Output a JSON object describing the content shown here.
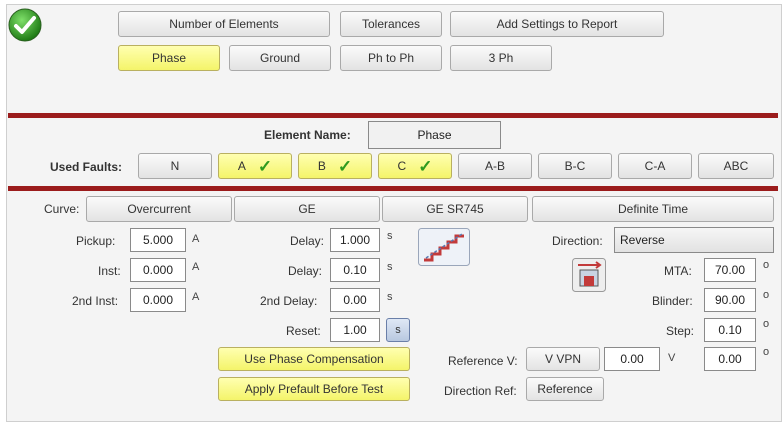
{
  "top_buttons": {
    "number_of_elements": "Number of Elements",
    "tolerances": "Tolerances",
    "add_settings": "Add Settings to Report"
  },
  "fault_type_tabs": [
    "Phase",
    "Ground",
    "Ph to Ph",
    "3 Ph"
  ],
  "element_name": {
    "label": "Element Name:",
    "value": "Phase"
  },
  "used_faults": {
    "label": "Used Faults:",
    "items": [
      {
        "label": "N",
        "selected": false
      },
      {
        "label": "A",
        "selected": true
      },
      {
        "label": "B",
        "selected": true
      },
      {
        "label": "C",
        "selected": true
      },
      {
        "label": "A-B",
        "selected": false
      },
      {
        "label": "B-C",
        "selected": false
      },
      {
        "label": "C-A",
        "selected": false
      },
      {
        "label": "ABC",
        "selected": false
      }
    ],
    "check_mark": "✓"
  },
  "curve": {
    "label": "Curve:",
    "type": "Overcurrent",
    "manufacturer": "GE",
    "model": "GE SR745",
    "characteristic": "Definite Time"
  },
  "settings": {
    "pickup": {
      "label": "Pickup:",
      "value": "5.000",
      "unit": "A"
    },
    "inst": {
      "label": "Inst:",
      "value": "0.000",
      "unit": "A"
    },
    "inst2": {
      "label": "2nd Inst:",
      "value": "0.000",
      "unit": "A"
    },
    "delay": {
      "label": "Delay:",
      "value": "1.000",
      "unit": "s"
    },
    "delay_b": {
      "label": "Delay:",
      "value": "0.10",
      "unit": "s"
    },
    "delay2": {
      "label": "2nd Delay:",
      "value": "0.00",
      "unit": "s"
    },
    "reset": {
      "label": "Reset:",
      "value": "1.00",
      "unit": "s"
    }
  },
  "direction": {
    "label": "Direction:",
    "value": "Reverse",
    "mta": {
      "label": "MTA:",
      "value": "70.00",
      "unit": "o"
    },
    "blinder": {
      "label": "Blinder:",
      "value": "90.00",
      "unit": "o"
    },
    "step": {
      "label": "Step:",
      "value": "0.10",
      "unit": "o"
    }
  },
  "reference_v": {
    "label": "Reference V:",
    "selection": "V VPN",
    "magnitude": "0.00",
    "magnitude_unit": "V",
    "angle": "0.00",
    "angle_unit": "o"
  },
  "direction_ref": {
    "label": "Direction Ref:",
    "value": "Reference"
  },
  "option_buttons": {
    "phase_compensation": "Use Phase Compensation",
    "prefault": "Apply Prefault Before Test"
  },
  "colors": {
    "accent_red": "#9b1c1c",
    "selected_yellow": "#f4f46a",
    "check_green": "#2f9a1f"
  }
}
